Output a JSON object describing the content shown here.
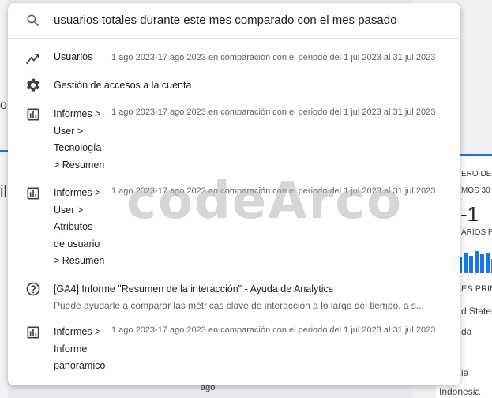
{
  "search": {
    "query": "usuarios totales durante este mes comparado con el mes pasado"
  },
  "results": [
    {
      "title": "Usuarios",
      "meta": "1 ago 2023-17 ago 2023 en comparación con el periodo del 1 jul 2023 al 31 jul 2023"
    },
    {
      "title": "Gestión de accesos a la cuenta"
    },
    {
      "title_lines": [
        "Informes >",
        "User >",
        "Tecnología",
        "> Resumen"
      ],
      "meta": "1 ago 2023-17 ago 2023 en comparación con el periodo del 1 jul 2023 al 31 jul 2023"
    },
    {
      "title_lines": [
        "Informes >",
        "User >",
        "Atributos",
        "de usuario",
        "> Resumen"
      ],
      "meta": "1 ago 2023-17 ago 2023 en comparación con el periodo del 1 jul 2023 al 31 jul 2023"
    },
    {
      "title": "[GA4] Informe \"Resumen de la interacción\" - Ayuda de Analytics",
      "subtitle": "Puede ayudarle a comparar las métricas clave de interacción a lo largo del tiempo, a s..."
    },
    {
      "title_lines": [
        "Informes >",
        "Informe",
        "panorámico"
      ],
      "meta": "1 ago 2023-17 ago 2023 en comparación con el periodo del 1 jul 2023 al 31 jul 2023"
    }
  ],
  "watermark": "codeArco",
  "background": {
    "left_fragment_1": "o",
    "left_fragment_2": "il",
    "right_label_1": "ERO DE",
    "right_label_2": "MOS 30",
    "right_value": "-1",
    "right_label_3": "ARIOS P",
    "right_label_4": "ES PRIM",
    "right_country_1": "d States",
    "right_country_2": "da",
    "right_country_3": "ia",
    "right_country_4": "Indonesia",
    "bottom_label": "ago"
  }
}
